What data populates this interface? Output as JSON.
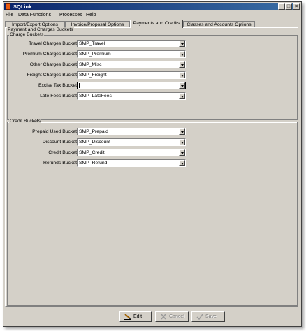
{
  "window": {
    "title": "SQLink"
  },
  "menu": [
    "File",
    "Data Functions",
    "Processes",
    "Help"
  ],
  "tabs": [
    {
      "label": "Import/Export Options",
      "active": false
    },
    {
      "label": "Invoice/Proposal Options",
      "active": false
    },
    {
      "label": "Payments and Credits",
      "active": true
    },
    {
      "label": "Classes and Accounts Options",
      "active": false
    }
  ],
  "section_title": "Payment and Charges Buckets",
  "charge_buckets": {
    "title": "Charge Buckets",
    "rows": [
      {
        "label": "Travel Charges Bucket",
        "value": "SMP_Travel"
      },
      {
        "label": "Premium Charges Bucket",
        "value": "SMP_Premium"
      },
      {
        "label": "Other Charges Bucket",
        "value": "SMP_Misc"
      },
      {
        "label": "Freight Charges Bucket",
        "value": "SMP_Freight"
      },
      {
        "label": "Excise Tax Bucket",
        "value": ""
      },
      {
        "label": "Late Fees Bucket",
        "value": "SMP_LateFees"
      }
    ]
  },
  "credit_buckets": {
    "title": "Credit Buckets",
    "rows": [
      {
        "label": "Prepaid Used Bucket",
        "value": "SMP_Prepaid"
      },
      {
        "label": "Discount Bucket",
        "value": "SMP_Discount"
      },
      {
        "label": "Credit Bucket",
        "value": "SMP_Credit"
      },
      {
        "label": "Refunds Bucket",
        "value": "SMP_Refund"
      }
    ]
  },
  "buttons": {
    "edit": "Edit",
    "cancel": "Cancel",
    "save": "Save"
  }
}
